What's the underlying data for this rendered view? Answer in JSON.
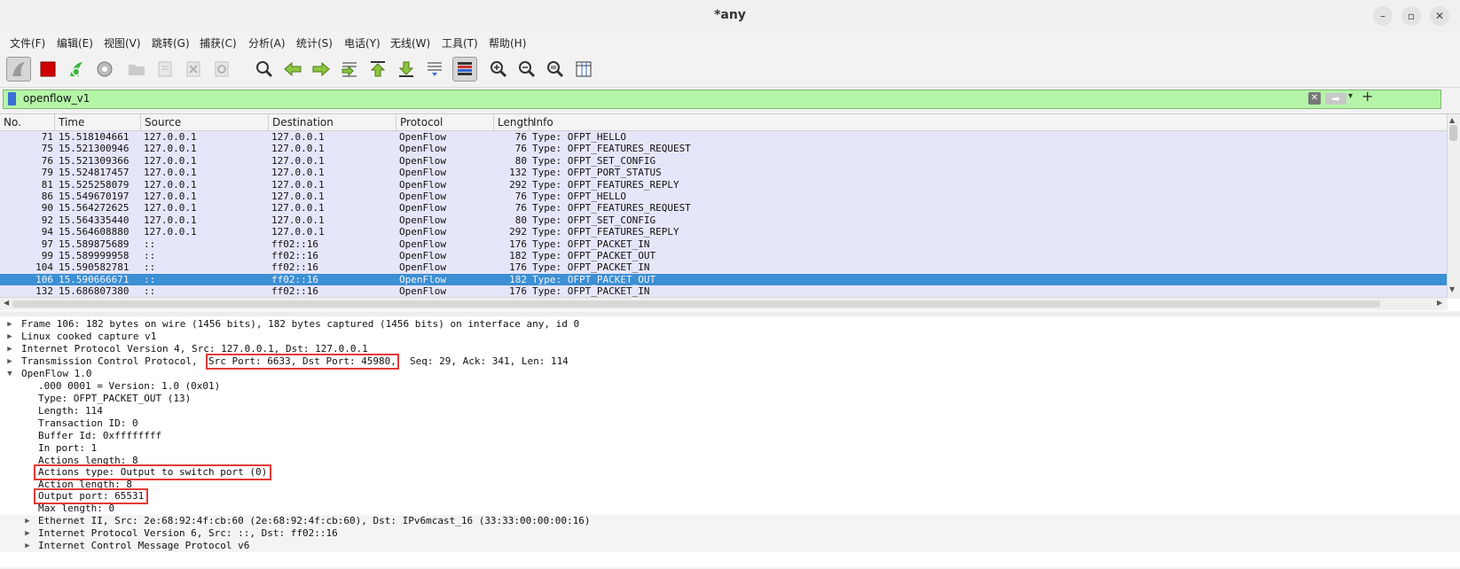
{
  "window": {
    "title": "*any"
  },
  "menu": [
    "文件(F)",
    "编辑(E)",
    "视图(V)",
    "跳转(G)",
    "捕获(C)",
    "分析(A)",
    "统计(S)",
    "电话(Y)",
    "无线(W)",
    "工具(T)",
    "帮助(H)"
  ],
  "filter": {
    "value": "openflow_v1"
  },
  "columns": [
    "No.",
    "Time",
    "Source",
    "Destination",
    "Protocol",
    "Length",
    "Info"
  ],
  "packets": [
    {
      "no": "71",
      "time": "15.518104661",
      "src": "127.0.0.1",
      "dst": "127.0.0.1",
      "proto": "OpenFlow",
      "len": "76",
      "info": "Type: OFPT_HELLO"
    },
    {
      "no": "75",
      "time": "15.521300946",
      "src": "127.0.0.1",
      "dst": "127.0.0.1",
      "proto": "OpenFlow",
      "len": "76",
      "info": "Type: OFPT_FEATURES_REQUEST"
    },
    {
      "no": "76",
      "time": "15.521309366",
      "src": "127.0.0.1",
      "dst": "127.0.0.1",
      "proto": "OpenFlow",
      "len": "80",
      "info": "Type: OFPT_SET_CONFIG"
    },
    {
      "no": "79",
      "time": "15.524817457",
      "src": "127.0.0.1",
      "dst": "127.0.0.1",
      "proto": "OpenFlow",
      "len": "132",
      "info": "Type: OFPT_PORT_STATUS"
    },
    {
      "no": "81",
      "time": "15.525258079",
      "src": "127.0.0.1",
      "dst": "127.0.0.1",
      "proto": "OpenFlow",
      "len": "292",
      "info": "Type: OFPT_FEATURES_REPLY"
    },
    {
      "no": "86",
      "time": "15.549670197",
      "src": "127.0.0.1",
      "dst": "127.0.0.1",
      "proto": "OpenFlow",
      "len": "76",
      "info": "Type: OFPT_HELLO"
    },
    {
      "no": "90",
      "time": "15.564272625",
      "src": "127.0.0.1",
      "dst": "127.0.0.1",
      "proto": "OpenFlow",
      "len": "76",
      "info": "Type: OFPT_FEATURES_REQUEST"
    },
    {
      "no": "92",
      "time": "15.564335440",
      "src": "127.0.0.1",
      "dst": "127.0.0.1",
      "proto": "OpenFlow",
      "len": "80",
      "info": "Type: OFPT_SET_CONFIG"
    },
    {
      "no": "94",
      "time": "15.564608880",
      "src": "127.0.0.1",
      "dst": "127.0.0.1",
      "proto": "OpenFlow",
      "len": "292",
      "info": "Type: OFPT_FEATURES_REPLY"
    },
    {
      "no": "97",
      "time": "15.589875689",
      "src": "::",
      "dst": "ff02::16",
      "proto": "OpenFlow",
      "len": "176",
      "info": "Type: OFPT_PACKET_IN"
    },
    {
      "no": "99",
      "time": "15.589999958",
      "src": "::",
      "dst": "ff02::16",
      "proto": "OpenFlow",
      "len": "182",
      "info": "Type: OFPT_PACKET_OUT"
    },
    {
      "no": "104",
      "time": "15.590582781",
      "src": "::",
      "dst": "ff02::16",
      "proto": "OpenFlow",
      "len": "176",
      "info": "Type: OFPT_PACKET_IN"
    },
    {
      "no": "106",
      "time": "15.590666671",
      "src": "::",
      "dst": "ff02::16",
      "proto": "OpenFlow",
      "len": "182",
      "info": "Type: OFPT_PACKET_OUT",
      "selected": true
    },
    {
      "no": "132",
      "time": "15.686807380",
      "src": "::",
      "dst": "ff02::16",
      "proto": "OpenFlow",
      "len": "176",
      "info": "Type: OFPT_PACKET_IN"
    }
  ],
  "details": {
    "frame": "Frame 106: 182 bytes on wire (1456 bits), 182 bytes captured (1456 bits) on interface any, id 0",
    "sll": "Linux cooked capture v1",
    "ip": "Internet Protocol Version 4, Src: 127.0.0.1, Dst: 127.0.0.1",
    "tcp_prefix": "Transmission Control Protocol,",
    "tcp_ports": "Src Port: 6633, Dst Port: 45980,",
    "tcp_suffix": "Seq: 29, Ack: 341, Len: 114",
    "openflow": "OpenFlow 1.0",
    "version": ".000 0001 = Version: 1.0 (0x01)",
    "type": "Type: OFPT_PACKET_OUT (13)",
    "length": "Length: 114",
    "xid": "Transaction ID: 0",
    "buffer": "Buffer Id: 0xffffffff",
    "in_port": "In port: 1",
    "actions_len": "Actions length: 8",
    "actions_type": "Actions type: Output to switch port (0)",
    "action_len": "Action length: 8",
    "output_port": "Output port: 65531",
    "max_len": "Max length: 0",
    "eth": "Ethernet II, Src: 2e:68:92:4f:cb:60 (2e:68:92:4f:cb:60), Dst: IPv6mcast_16 (33:33:00:00:00:16)",
    "ipv6": "Internet Protocol Version 6, Src: ::, Dst: ff02::16",
    "icmpv6": "Internet Control Message Protocol v6"
  }
}
